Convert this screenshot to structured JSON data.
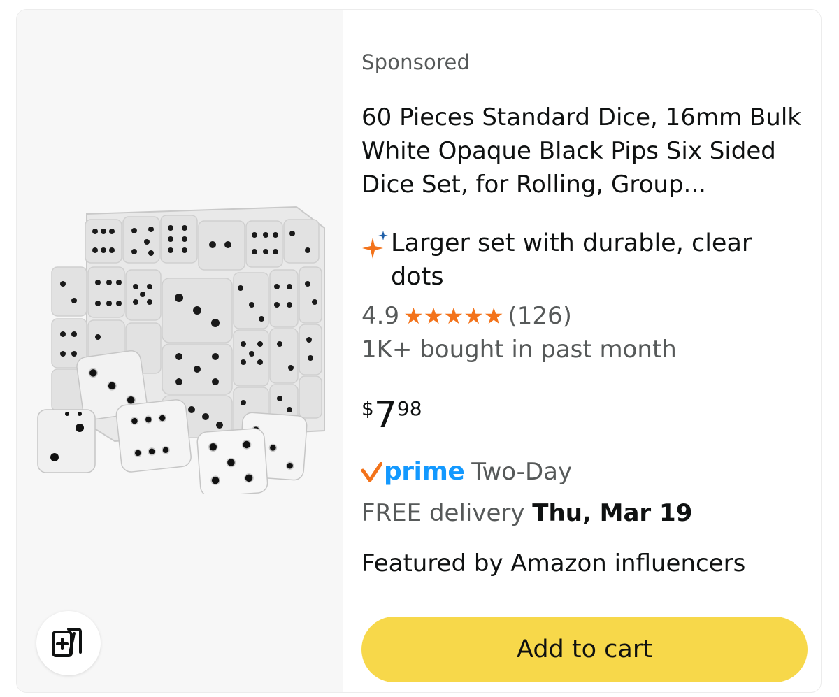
{
  "product": {
    "sponsored_label": "Sponsored",
    "title": "60 Pieces Standard Dice, 16mm Bulk White Opaque Black Pips Six Sided Dice Set, for Rolling, Group...",
    "highlight": "Larger set with durable, clear dots",
    "rating": "4.9",
    "rating_value": 4.9,
    "rating_count": "(126)",
    "bought_text": "1K+ bought in past month",
    "price": {
      "symbol": "$",
      "whole": "7",
      "fraction": "98"
    },
    "prime": {
      "word": "prime",
      "label": "Two-Day"
    },
    "delivery": {
      "prefix": "FREE delivery ",
      "date": "Thu, Mar 19"
    },
    "featured_text": "Featured by Amazon influencers",
    "add_to_cart_label": "Add to cart"
  },
  "colors": {
    "star": "#f3731b",
    "prime_blue": "#1399ff",
    "prime_check": "#f3731b",
    "button": "#f7d84a",
    "image_bg": "#f7f7f7"
  },
  "icons": {
    "sparkle": "sparkle-icon",
    "compare": "compare-cards-icon",
    "prime_check": "prime-check-icon"
  }
}
